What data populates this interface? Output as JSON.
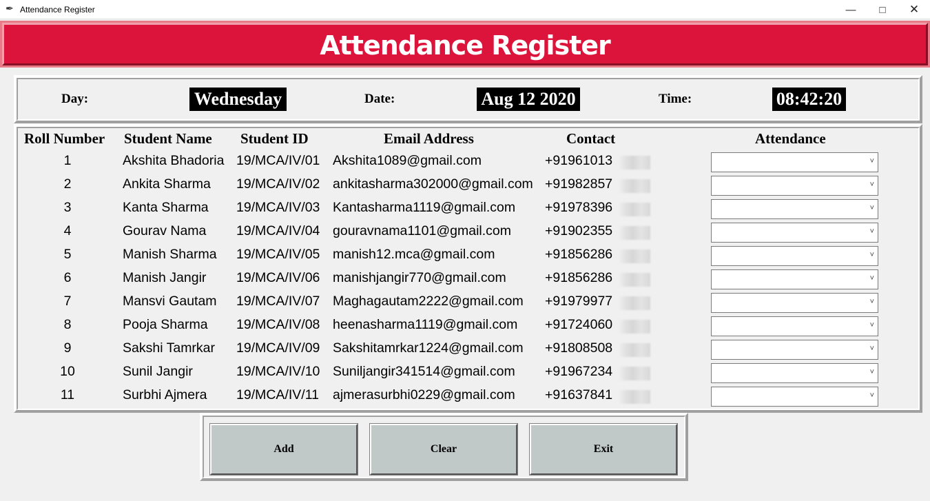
{
  "window": {
    "title": "Attendance Register",
    "icons": [
      "feather-icon",
      "minimize-icon",
      "maximize-icon",
      "close-icon"
    ]
  },
  "header": {
    "title": "Attendance Register"
  },
  "info": {
    "day_label": "Day:",
    "day_value": "Wednesday",
    "date_label": "Date:",
    "date_value": "Aug 12 2020",
    "time_label": "Time:",
    "time_value": "08:42:20"
  },
  "table": {
    "columns": [
      "Roll Number",
      "Student Name",
      "Student ID",
      "Email Address",
      "Contact",
      "Attendance"
    ],
    "rows": [
      {
        "roll": "1",
        "name": "Akshita Bhadoria",
        "id": "19/MCA/IV/01",
        "email": "Akshita1089@gmail.com",
        "contact": "+91961013"
      },
      {
        "roll": "2",
        "name": "Ankita Sharma",
        "id": "19/MCA/IV/02",
        "email": "ankitasharma302000@gmail.com",
        "contact": "+91982857"
      },
      {
        "roll": "3",
        "name": "Kanta Sharma",
        "id": "19/MCA/IV/03",
        "email": "Kantasharma1119@gmail.com",
        "contact": "+91978396"
      },
      {
        "roll": "4",
        "name": "Gourav Nama",
        "id": "19/MCA/IV/04",
        "email": "gouravnama1101@gmail.com",
        "contact": "+91902355"
      },
      {
        "roll": "5",
        "name": "Manish Sharma",
        "id": "19/MCA/IV/05",
        "email": "manish12.mca@gmail.com",
        "contact": "+91856286"
      },
      {
        "roll": "6",
        "name": "Manish Jangir",
        "id": "19/MCA/IV/06",
        "email": "manishjangir770@gmail.com",
        "contact": "+91856286"
      },
      {
        "roll": "7",
        "name": "Mansvi Gautam",
        "id": "19/MCA/IV/07",
        "email": "Maghagautam2222@gmail.com",
        "contact": "+91979977"
      },
      {
        "roll": "8",
        "name": "Pooja Sharma",
        "id": "19/MCA/IV/08",
        "email": "heenasharma1119@gmail.com",
        "contact": "+91724060"
      },
      {
        "roll": "9",
        "name": "Sakshi Tamrkar",
        "id": "19/MCA/IV/09",
        "email": "Sakshitamrkar1224@gmail.com",
        "contact": "+91808508"
      },
      {
        "roll": "10",
        "name": "Sunil Jangir",
        "id": "19/MCA/IV/10",
        "email": "Suniljangir341514@gmail.com",
        "contact": "+91967234"
      },
      {
        "roll": "11",
        "name": "Surbhi Ajmera",
        "id": "19/MCA/IV/11",
        "email": "ajmerasurbhi0229@gmail.com",
        "contact": "+91637841"
      }
    ],
    "attendance_values": [
      "",
      "",
      "",
      "",
      "",
      "",
      "",
      "",
      "",
      "",
      ""
    ]
  },
  "buttons": {
    "add": "Add",
    "clear": "Clear",
    "exit": "Exit"
  },
  "colors": {
    "banner": "#dc143c",
    "button": "#c0c8c8",
    "value_bg": "#000000"
  }
}
